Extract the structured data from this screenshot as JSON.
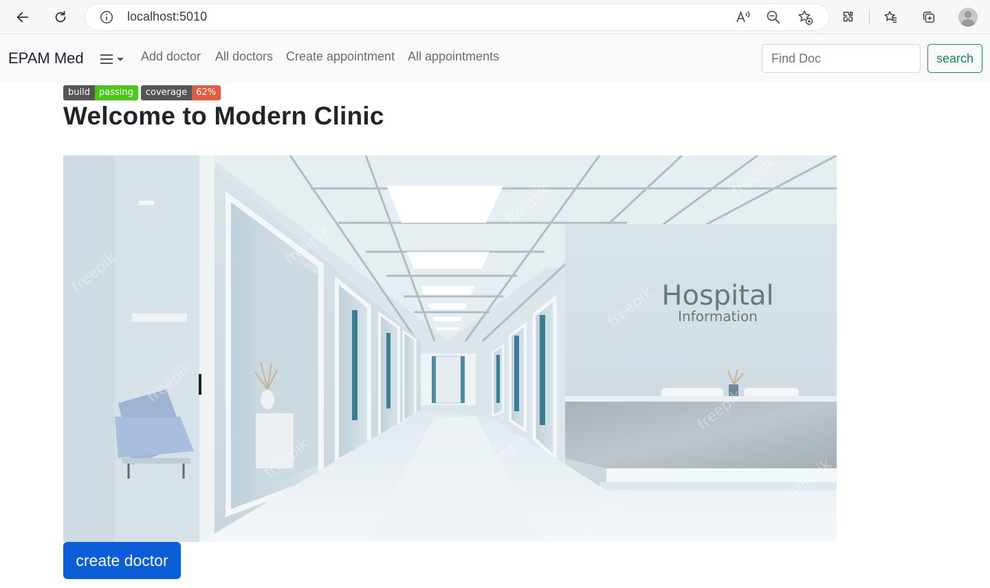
{
  "browser": {
    "url": "localhost:5010",
    "icons": [
      "back-arrow-icon",
      "refresh-icon",
      "info-icon",
      "read-aloud-icon",
      "zoom-out-icon",
      "add-favorite-icon",
      "extensions-icon",
      "favorites-icon",
      "collections-icon",
      "profile-avatar"
    ]
  },
  "navbar": {
    "brand": "EPAM Med",
    "links": [
      "Add doctor",
      "All doctors",
      "Create appointment",
      "All appointments"
    ],
    "search_placeholder": "Find Doc",
    "search_button": "search",
    "search_button_color": "#198754"
  },
  "badges": [
    {
      "key": "build",
      "value": "passing",
      "color": "#4cc61e"
    },
    {
      "key": "coverage",
      "value": "62%",
      "color": "#e05d44"
    }
  ],
  "main": {
    "title": "Welcome to Modern Clinic",
    "hero_image": {
      "wall_text_line1": "Hospital",
      "wall_text_line2": "Information",
      "watermark": "freepik"
    },
    "primary_button": "create doctor",
    "primary_color": "#0b5ed7"
  }
}
